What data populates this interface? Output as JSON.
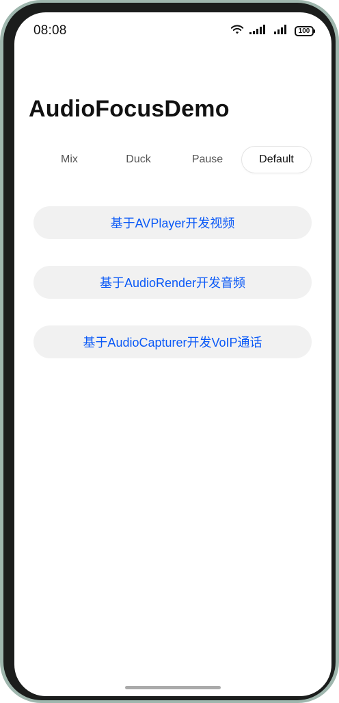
{
  "status_bar": {
    "time": "08:08",
    "battery_level": "100",
    "icons": [
      "wifi-icon",
      "signal-icon",
      "signal-icon",
      "battery-icon"
    ]
  },
  "page": {
    "title": "AudioFocusDemo"
  },
  "tabs": [
    {
      "label": "Mix",
      "selected": false
    },
    {
      "label": "Duck",
      "selected": false
    },
    {
      "label": "Pause",
      "selected": false
    },
    {
      "label": "Default",
      "selected": true
    }
  ],
  "actions": [
    {
      "label": "基于AVPlayer开发视频"
    },
    {
      "label": "基于AudioRender开发音频"
    },
    {
      "label": "基于AudioCapturer开发VoIP通话"
    }
  ],
  "colors": {
    "accent": "#0a59f7",
    "button_bg": "#f1f1f1",
    "frame": "#9fb7ae"
  }
}
